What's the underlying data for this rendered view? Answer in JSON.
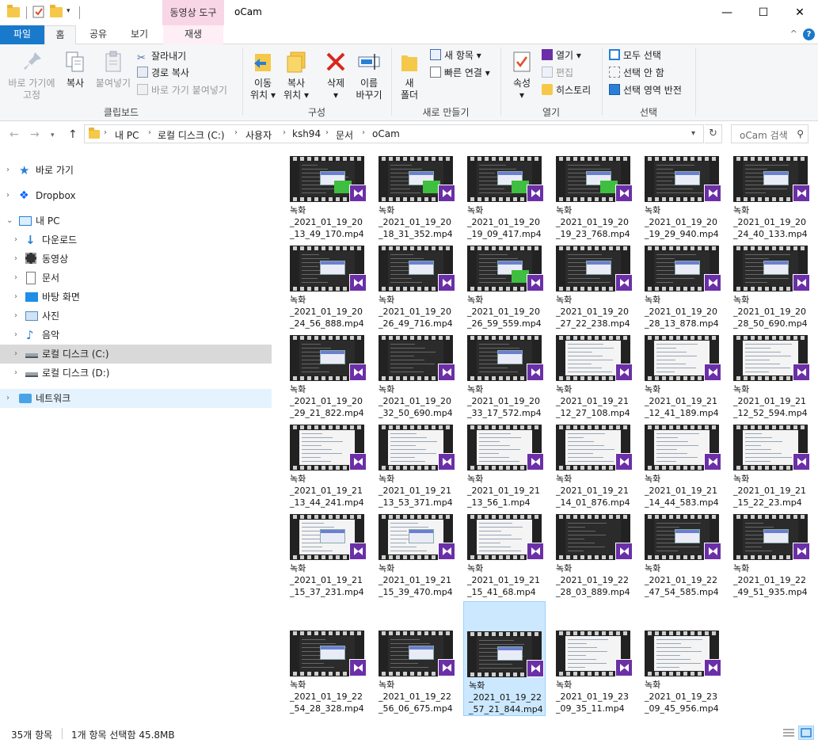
{
  "window": {
    "title": "oCam",
    "context_tool_label": "동영상 도구",
    "buttons": {
      "minimize": "—",
      "maximize": "☐",
      "close": "✕"
    }
  },
  "tabs": {
    "file": "파일",
    "home": "홈",
    "share": "공유",
    "view": "보기",
    "play": "재생",
    "collapse": "^",
    "help": "?"
  },
  "ribbon": {
    "clipboard": {
      "pin_line1": "바로 가기에",
      "pin_line2": "고정",
      "copy": "복사",
      "paste": "붙여넣기",
      "cut": "잘라내기",
      "copy_path": "경로 복사",
      "paste_shortcut": "바로 가기 붙여넣기",
      "label": "클립보드"
    },
    "organize": {
      "move_line1": "이동",
      "move_line2": "위치",
      "copyto_line1": "복사",
      "copyto_line2": "위치",
      "delete": "삭제",
      "rename_line1": "이름",
      "rename_line2": "바꾸기",
      "label": "구성"
    },
    "new": {
      "new_folder_line1": "새",
      "new_folder_line2": "폴더",
      "new_item": "새 항목",
      "easy_access": "빠른 연결",
      "label": "새로 만들기"
    },
    "open": {
      "properties": "속성",
      "open": "열기",
      "edit": "편집",
      "history": "히스토리",
      "label": "열기"
    },
    "select": {
      "select_all": "모두 선택",
      "select_none": "선택 안 함",
      "invert": "선택 영역 반전",
      "label": "선택"
    }
  },
  "address": {
    "crumbs": [
      "내 PC",
      "로컬 디스크 (C:)",
      "사용자",
      "ksh94",
      "문서",
      "oCam"
    ],
    "search_placeholder": "oCam 검색"
  },
  "nav": {
    "quick_access": "바로 가기",
    "dropbox": "Dropbox",
    "this_pc": "내 PC",
    "downloads": "다운로드",
    "videos": "동영상",
    "documents": "문서",
    "desktop": "바탕 화면",
    "pictures": "사진",
    "music": "음악",
    "disk_c": "로컬 디스크 (C:)",
    "disk_d": "로컬 디스크 (D:)",
    "network": "네트워크"
  },
  "files": [
    {
      "name": "녹화\n_2021_01_19_20\n_13_49_170.mp4",
      "style": "dark-green"
    },
    {
      "name": "녹화\n_2021_01_19_20\n_18_31_352.mp4",
      "style": "dark-green"
    },
    {
      "name": "녹화\n_2021_01_19_20\n_19_09_417.mp4",
      "style": "dark-green"
    },
    {
      "name": "녹화\n_2021_01_19_20\n_19_23_768.mp4",
      "style": "dark-green"
    },
    {
      "name": "녹화\n_2021_01_19_20\n_19_29_940.mp4",
      "style": "dark-dialog"
    },
    {
      "name": "녹화\n_2021_01_19_20\n_24_40_133.mp4",
      "style": "dark-dialog"
    },
    {
      "name": "녹화\n_2021_01_19_20\n_24_56_888.mp4",
      "style": "dark-dialog"
    },
    {
      "name": "녹화\n_2021_01_19_20\n_26_49_716.mp4",
      "style": "dark-dialog"
    },
    {
      "name": "녹화\n_2021_01_19_20\n_26_59_559.mp4",
      "style": "dark-green"
    },
    {
      "name": "녹화\n_2021_01_19_20\n_27_22_238.mp4",
      "style": "dark-dialog"
    },
    {
      "name": "녹화\n_2021_01_19_20\n_28_13_878.mp4",
      "style": "dark-dialog"
    },
    {
      "name": "녹화\n_2021_01_19_20\n_28_50_690.mp4",
      "style": "dark-dialog"
    },
    {
      "name": "녹화\n_2021_01_19_20\n_29_21_822.mp4",
      "style": "dark-dialog"
    },
    {
      "name": "녹화\n_2021_01_19_20\n_32_50_690.mp4",
      "style": "dark"
    },
    {
      "name": "녹화\n_2021_01_19_20\n_33_17_572.mp4",
      "style": "dark-dialog"
    },
    {
      "name": "녹화\n_2021_01_19_21\n_12_27_108.mp4",
      "style": "light"
    },
    {
      "name": "녹화\n_2021_01_19_21\n_12_41_189.mp4",
      "style": "light"
    },
    {
      "name": "녹화\n_2021_01_19_21\n_12_52_594.mp4",
      "style": "light"
    },
    {
      "name": "녹화\n_2021_01_19_21\n_13_44_241.mp4",
      "style": "light"
    },
    {
      "name": "녹화\n_2021_01_19_21\n_13_53_371.mp4",
      "style": "light"
    },
    {
      "name": "녹화\n_2021_01_19_21\n_13_56_1.mp4",
      "style": "light"
    },
    {
      "name": "녹화\n_2021_01_19_21\n_14_01_876.mp4",
      "style": "light"
    },
    {
      "name": "녹화\n_2021_01_19_21\n_14_44_583.mp4",
      "style": "light"
    },
    {
      "name": "녹화\n_2021_01_19_21\n_15_22_23.mp4",
      "style": "light"
    },
    {
      "name": "녹화\n_2021_01_19_21\n_15_37_231.mp4",
      "style": "light-dialog"
    },
    {
      "name": "녹화\n_2021_01_19_21\n_15_39_470.mp4",
      "style": "light-dialog"
    },
    {
      "name": "녹화\n_2021_01_19_21\n_15_41_68.mp4",
      "style": "light"
    },
    {
      "name": "녹화\n_2021_01_19_22\n_28_03_889.mp4",
      "style": "dark"
    },
    {
      "name": "녹화\n_2021_01_19_22\n_47_54_585.mp4",
      "style": "dark-dialog"
    },
    {
      "name": "녹화\n_2021_01_19_22\n_49_51_935.mp4",
      "style": "dark-dialog"
    },
    {
      "name": "녹화\n_2021_01_19_22\n_54_28_328.mp4",
      "style": "dark-dialog"
    },
    {
      "name": "녹화\n_2021_01_19_22\n_56_06_675.mp4",
      "style": "dark-dialog"
    },
    {
      "name": "녹화\n_2021_01_19_22\n_57_21_844.mp4",
      "style": "dark-dialog",
      "selected": true
    },
    {
      "name": "녹화\n_2021_01_19_23\n_09_35_11.mp4",
      "style": "light"
    },
    {
      "name": "녹화\n_2021_01_19_23\n_09_45_956.mp4",
      "style": "light"
    }
  ],
  "status": {
    "count": "35개 항목",
    "selection": "1개 항목 선택함 45.8MB"
  },
  "colors": {
    "accent": "#1979ca",
    "selection_bg": "#cce8ff",
    "selection_border": "#99d1ff",
    "play_badge": "#6b2fa7",
    "context_tab": "#f9d6e6"
  },
  "icons": {
    "play_badge": "video-file-icon",
    "search": "search-icon",
    "refresh": "refresh-icon"
  }
}
